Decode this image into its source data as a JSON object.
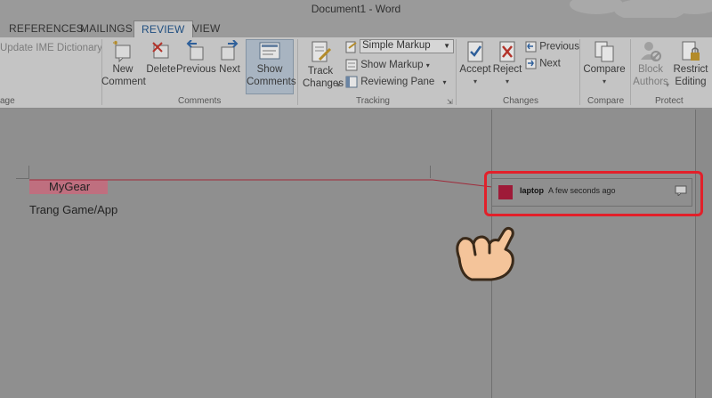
{
  "window": {
    "title": "Document1 - Word"
  },
  "tabs": [
    {
      "label": "REFERENCES"
    },
    {
      "label": "MAILINGS"
    },
    {
      "label": "REVIEW"
    },
    {
      "label": "VIEW"
    }
  ],
  "ribbon": {
    "language": {
      "update_ime": "Update IME Dictionary",
      "group_label": "age"
    },
    "comments": {
      "new_comment": "New Comment",
      "delete": "Delete",
      "previous": "Previous",
      "next": "Next",
      "show_comments": "Show Comments",
      "group_label": "Comments"
    },
    "tracking": {
      "track_changes": "Track Changes",
      "markup_select": "Simple Markup",
      "show_markup": "Show Markup",
      "reviewing_pane": "Reviewing Pane",
      "group_label": "Tracking"
    },
    "changes": {
      "accept": "Accept",
      "reject": "Reject",
      "previous": "Previous",
      "next": "Next",
      "group_label": "Changes"
    },
    "compare": {
      "compare": "Compare",
      "group_label": "Compare"
    },
    "protect": {
      "block_authors": "Block Authors",
      "restrict_editing": "Restrict Editing",
      "group_label": "Protect"
    }
  },
  "document": {
    "commented_text": "MyGear",
    "body_text": "Trang Game/App"
  },
  "comment": {
    "author": "laptop",
    "time": "A few seconds ago"
  },
  "colors": {
    "highlight_border": "#e2202a",
    "comment_anchor": "#bf6f7f",
    "avatar": "#9e1a38"
  }
}
